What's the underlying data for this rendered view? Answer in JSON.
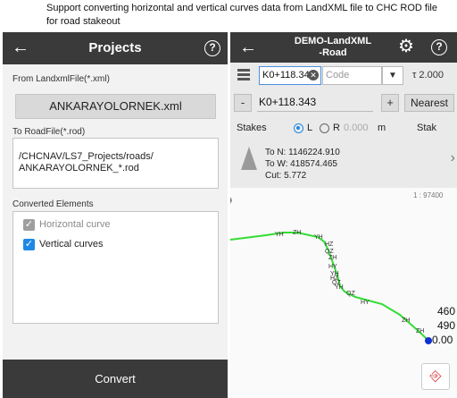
{
  "caption": "Support converting horizontal and vertical curves data from LandXML file to CHC ROD file for road stakeout",
  "left": {
    "back_icon": "arrow-left-icon",
    "title": "Projects",
    "help": "?",
    "from_label": "From LandxmlFile(*.xml)",
    "from_file": "ANKARAYOLORNEK.xml",
    "to_label": "To RoadFile(*.rod)",
    "to_path_line1": "/CHCNAV/LS7_Projects/roads/",
    "to_path_line2": "ANKARAYOLORNEK_*.rod",
    "elements_label": "Converted Elements",
    "elements": [
      {
        "label": "Horizontal curve",
        "checked": true,
        "disabled": true
      },
      {
        "label": "Vertical curves",
        "checked": true,
        "disabled": false
      }
    ],
    "convert": "Convert"
  },
  "right": {
    "title_line1": "DEMO-LandXML",
    "title_line2": "-Road",
    "help": "?",
    "station_value": "K0+118.343",
    "code_placeholder": "Code",
    "antenna_height": "2.000",
    "minus": "-",
    "plus": "+",
    "station_input": "K0+118.343",
    "nearest": "Nearest",
    "stakes": "Stakes",
    "side_left": "L",
    "side_right": "R",
    "offset": "0.000",
    "unit": "m",
    "stake_label": "Stak",
    "to_n": "To N: 1146224.910",
    "to_w": "To W: 418574.465",
    "cut": "Cut: 5.772",
    "scale": "1 : 97400",
    "map_labels": [
      "YH",
      "ZH",
      "YH",
      "HZ",
      "QZ",
      "ZH",
      "HY",
      "YH",
      "HZ",
      "QZ",
      "YH",
      "QZ",
      "HY",
      "ZH",
      "ZH"
    ],
    "edge_nums": [
      "460",
      "490",
      "0.00"
    ],
    "colors": {
      "route": "#33dd33",
      "position": "#1030d0",
      "accent": "#1e88e5"
    }
  }
}
